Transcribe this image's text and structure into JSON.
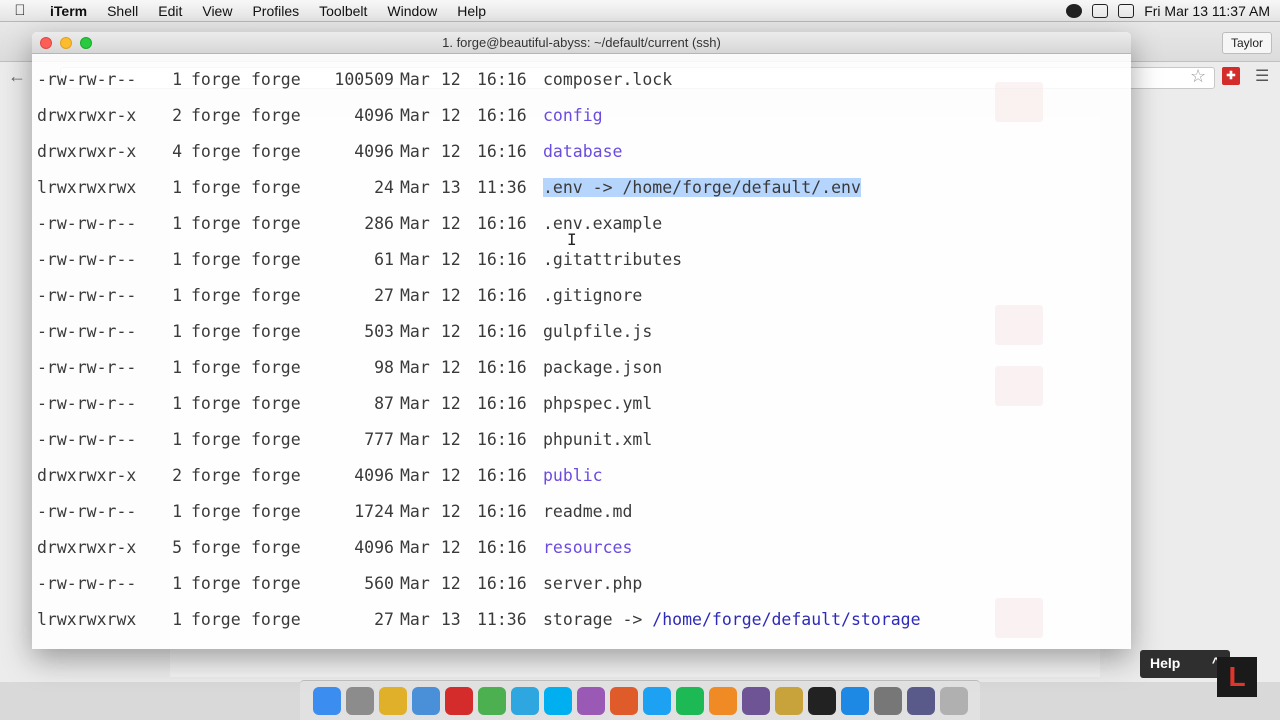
{
  "menubar": {
    "app": "iTerm",
    "items": [
      "Shell",
      "Edit",
      "View",
      "Profiles",
      "Toolbelt",
      "Window",
      "Help"
    ],
    "clock": "Fri Mar 13  11:37 AM"
  },
  "browser": {
    "profile": "Taylor"
  },
  "terminal": {
    "title": "1. forge@beautiful-abyss: ~/default/current (ssh)",
    "rows": [
      {
        "perm": "-rw-rw-r--",
        "links": "1",
        "owner": "forge",
        "group": "forge",
        "size": "100509",
        "month": "Mar",
        "day": "12",
        "time": "16:16",
        "name": "composer.lock",
        "kind": "file",
        "target": ""
      },
      {
        "perm": "drwxrwxr-x",
        "links": "2",
        "owner": "forge",
        "group": "forge",
        "size": "4096",
        "month": "Mar",
        "day": "12",
        "time": "16:16",
        "name": "config",
        "kind": "dir",
        "target": ""
      },
      {
        "perm": "drwxrwxr-x",
        "links": "4",
        "owner": "forge",
        "group": "forge",
        "size": "4096",
        "month": "Mar",
        "day": "12",
        "time": "16:16",
        "name": "database",
        "kind": "dir",
        "target": ""
      },
      {
        "perm": "lrwxrwxrwx",
        "links": "1",
        "owner": "forge",
        "group": "forge",
        "size": "24",
        "month": "Mar",
        "day": "13",
        "time": "11:36",
        "name": ".env",
        "kind": "link-selected",
        "target": "/home/forge/default/.env"
      },
      {
        "perm": "-rw-rw-r--",
        "links": "1",
        "owner": "forge",
        "group": "forge",
        "size": "286",
        "month": "Mar",
        "day": "12",
        "time": "16:16",
        "name": ".env.example",
        "kind": "file",
        "target": ""
      },
      {
        "perm": "-rw-rw-r--",
        "links": "1",
        "owner": "forge",
        "group": "forge",
        "size": "61",
        "month": "Mar",
        "day": "12",
        "time": "16:16",
        "name": ".gitattributes",
        "kind": "file",
        "target": ""
      },
      {
        "perm": "-rw-rw-r--",
        "links": "1",
        "owner": "forge",
        "group": "forge",
        "size": "27",
        "month": "Mar",
        "day": "12",
        "time": "16:16",
        "name": ".gitignore",
        "kind": "file",
        "target": ""
      },
      {
        "perm": "-rw-rw-r--",
        "links": "1",
        "owner": "forge",
        "group": "forge",
        "size": "503",
        "month": "Mar",
        "day": "12",
        "time": "16:16",
        "name": "gulpfile.js",
        "kind": "file",
        "target": ""
      },
      {
        "perm": "-rw-rw-r--",
        "links": "1",
        "owner": "forge",
        "group": "forge",
        "size": "98",
        "month": "Mar",
        "day": "12",
        "time": "16:16",
        "name": "package.json",
        "kind": "file",
        "target": ""
      },
      {
        "perm": "-rw-rw-r--",
        "links": "1",
        "owner": "forge",
        "group": "forge",
        "size": "87",
        "month": "Mar",
        "day": "12",
        "time": "16:16",
        "name": "phpspec.yml",
        "kind": "file",
        "target": ""
      },
      {
        "perm": "-rw-rw-r--",
        "links": "1",
        "owner": "forge",
        "group": "forge",
        "size": "777",
        "month": "Mar",
        "day": "12",
        "time": "16:16",
        "name": "phpunit.xml",
        "kind": "file",
        "target": ""
      },
      {
        "perm": "drwxrwxr-x",
        "links": "2",
        "owner": "forge",
        "group": "forge",
        "size": "4096",
        "month": "Mar",
        "day": "12",
        "time": "16:16",
        "name": "public",
        "kind": "dir",
        "target": ""
      },
      {
        "perm": "-rw-rw-r--",
        "links": "1",
        "owner": "forge",
        "group": "forge",
        "size": "1724",
        "month": "Mar",
        "day": "12",
        "time": "16:16",
        "name": "readme.md",
        "kind": "file",
        "target": ""
      },
      {
        "perm": "drwxrwxr-x",
        "links": "5",
        "owner": "forge",
        "group": "forge",
        "size": "4096",
        "month": "Mar",
        "day": "12",
        "time": "16:16",
        "name": "resources",
        "kind": "dir",
        "target": ""
      },
      {
        "perm": "-rw-rw-r--",
        "links": "1",
        "owner": "forge",
        "group": "forge",
        "size": "560",
        "month": "Mar",
        "day": "12",
        "time": "16:16",
        "name": "server.php",
        "kind": "file",
        "target": ""
      },
      {
        "perm": "lrwxrwxrwx",
        "links": "1",
        "owner": "forge",
        "group": "forge",
        "size": "27",
        "month": "Mar",
        "day": "13",
        "time": "11:36",
        "name": "storage",
        "kind": "link",
        "target": "/home/forge/default/storage"
      }
    ]
  },
  "help_widget": {
    "label": "Help",
    "chevron": "^",
    "logo_letter": "L"
  },
  "colors": {
    "directory": "#6b4be0",
    "symlink_target": "#2d2ab8",
    "selection": "#b6d5fd"
  },
  "dock": {
    "icons": [
      "finder-icon",
      "launchpad-icon",
      "chrome-icon",
      "preview-icon",
      "pocket-icon",
      "adium-icon",
      "telegram-icon",
      "skype-icon",
      "podcasts-icon",
      "sublime-icon",
      "twitter-icon",
      "spotify-icon",
      "sublime-text-icon",
      "github-icon",
      "database-icon",
      "terminal-icon",
      "app-store-icon",
      "system-preferences-icon",
      "imovie-icon",
      "trash-icon"
    ]
  }
}
